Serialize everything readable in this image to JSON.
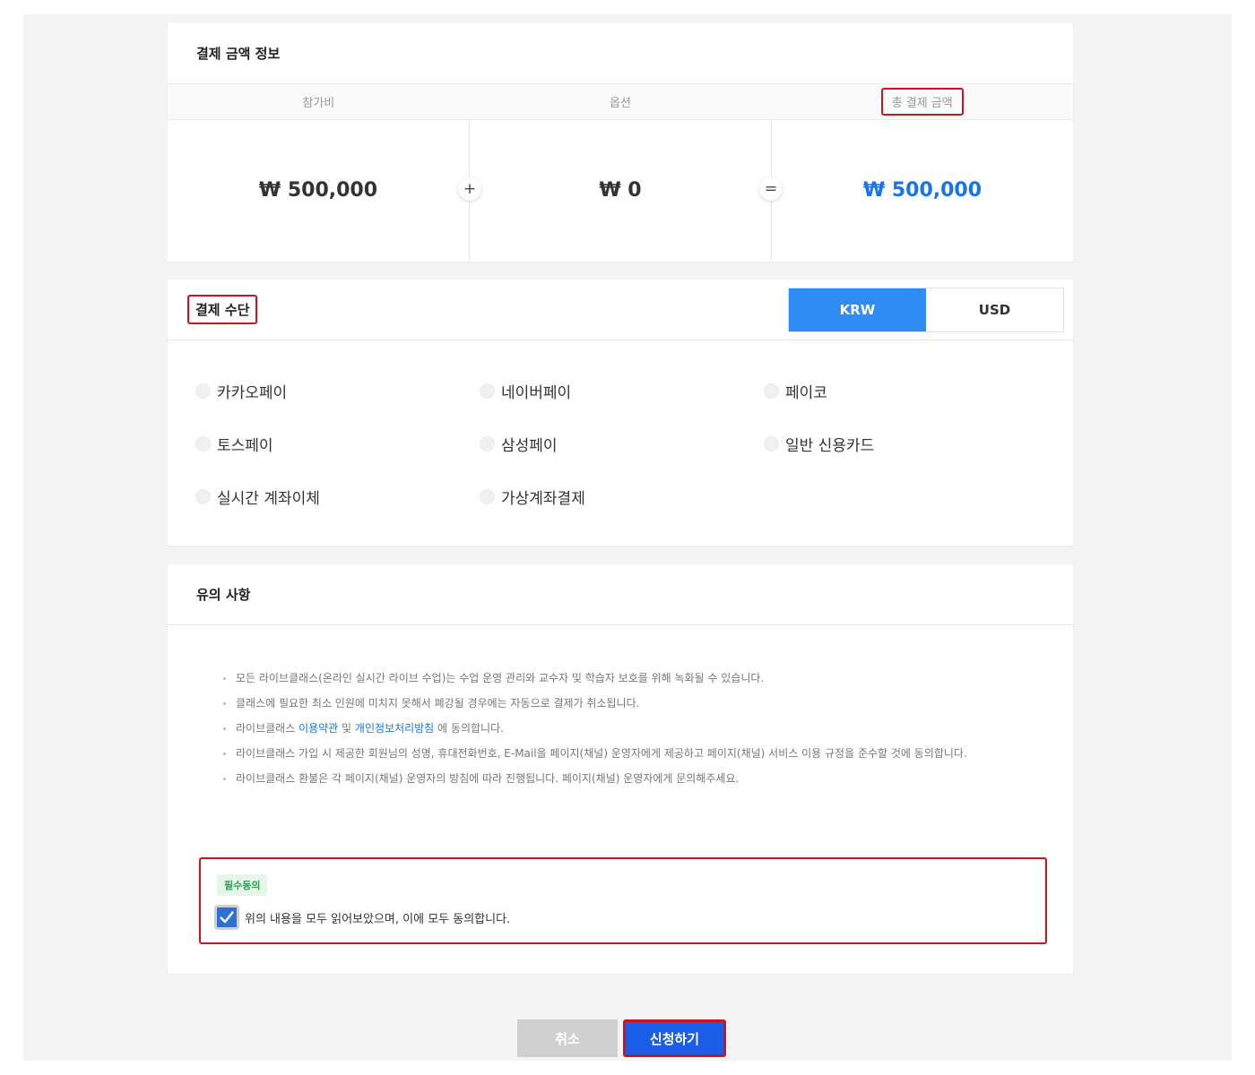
{
  "amount_section": {
    "title": "결제 금액 정보",
    "headers": [
      "참가비",
      "옵션",
      "총 결제 금액"
    ],
    "values": [
      "₩ 500,000",
      "₩ 0",
      "₩ 500,000"
    ],
    "operators": [
      "+",
      "="
    ]
  },
  "payment_section": {
    "title": "결제 수단",
    "currencies": [
      "KRW",
      "USD"
    ],
    "selected_currency": "KRW",
    "methods": [
      "카카오페이",
      "네이버페이",
      "페이코",
      "토스페이",
      "삼성페이",
      "일반 신용카드",
      "실시간 계좌이체",
      "가상계좌결제"
    ]
  },
  "notice_section": {
    "title": "유의 사항",
    "items": [
      "모든 라이브클래스(온라인 실시간 라이브 수업)는 수업 운영 관리와 교수자 및 학습자 보호를 위해 녹화될 수 있습니다.",
      "클래스에 필요한 최소 인원에 미치지 못해서 폐강될 경우에는 자동으로 결제가 취소됩니다.",
      {
        "prefix": "라이브클래스 ",
        "link1": "이용약관",
        "middle": " 및 ",
        "link2": "개인정보처리방침",
        "suffix": " 에 동의합니다."
      },
      "라이브클래스 가입 시 제공한 회원님의 성명, 휴대전화번호, E-Mail을 페이지(채널) 운영자에게 제공하고 페이지(채널) 서비스 이용 규정을 준수할 것에 동의합니다.",
      "라이브클래스 환불은 각 페이지(채널) 운영자의 방침에 따라 진행됩니다. 페이지(채널) 운영자에게 문의해주세요."
    ],
    "required_badge": "필수동의",
    "agree_text": "위의 내용을 모두 읽어보았으며, 이에 모두 동의합니다.",
    "agree_checked": true
  },
  "buttons": {
    "cancel": "취소",
    "submit": "신청하기"
  },
  "colors": {
    "accent_blue": "#1a74e8",
    "krw_active": "#2f8cf5",
    "submit_bg": "#1a5ee8",
    "annotation_red": "#d3101e",
    "badge_green": "#2f9e53"
  }
}
